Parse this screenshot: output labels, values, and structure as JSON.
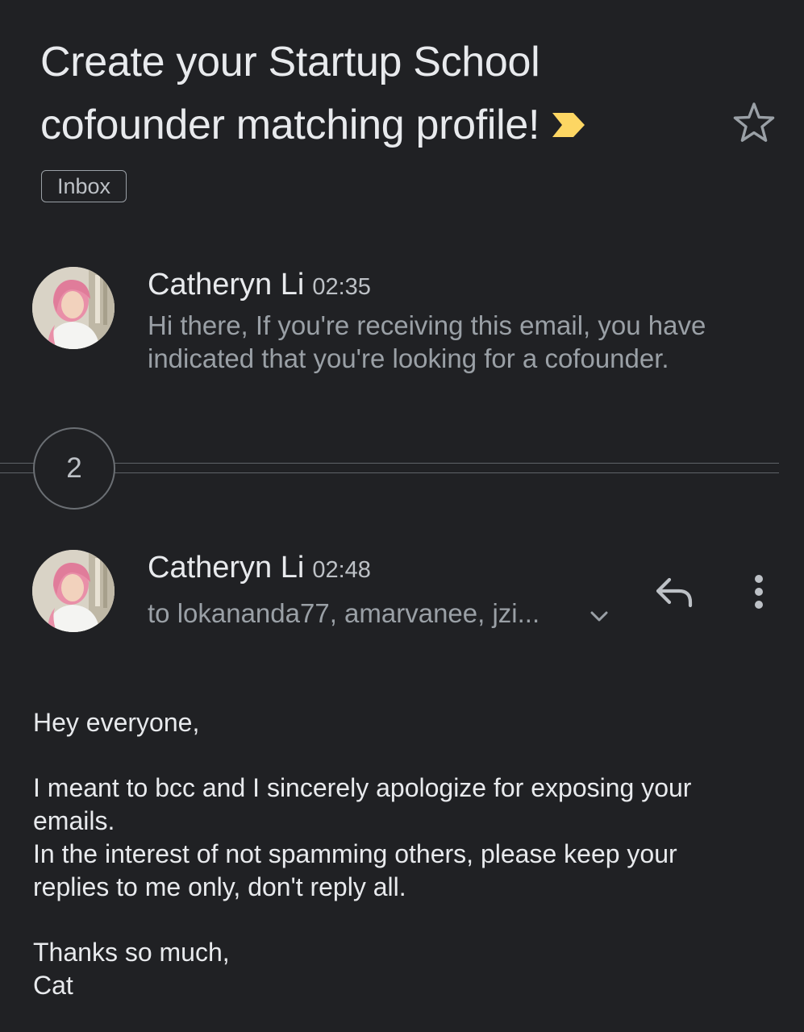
{
  "subject": {
    "line1": "Create your Startup School",
    "line2": "cofounder matching profile!",
    "importance_marker_color": "#fdd663",
    "star_icon": "star-outline-icon"
  },
  "labels": [
    "Inbox"
  ],
  "collapsed_message": {
    "sender": "Catheryn Li",
    "time": "02:35",
    "snippet_line1": "Hi there, If you're receiving this email, you have",
    "snippet_line2": "indicated that you're looking for a cofounder."
  },
  "hidden_messages": {
    "count": "2"
  },
  "expanded_message": {
    "sender": "Catheryn Li",
    "time": "02:48",
    "recipients": "to lokananda77, amarvanee, jzi...",
    "actions": {
      "reply_icon": "reply-icon",
      "more_icon": "more-vert-icon",
      "expand_icon": "chevron-down-icon"
    },
    "body": {
      "greeting": "Hey everyone,",
      "p1_line1": "I meant to bcc and I sincerely apologize for exposing your",
      "p1_line2": "emails.",
      "p2_line1": "In the interest of not spamming others, please keep your",
      "p2_line2": "replies to me only, don't reply all.",
      "signoff": "Thanks so much,",
      "signature": "Cat"
    }
  },
  "theme": {
    "background": "#202124",
    "primary_text": "#e8eaed",
    "secondary_text": "#9aa0a6"
  }
}
